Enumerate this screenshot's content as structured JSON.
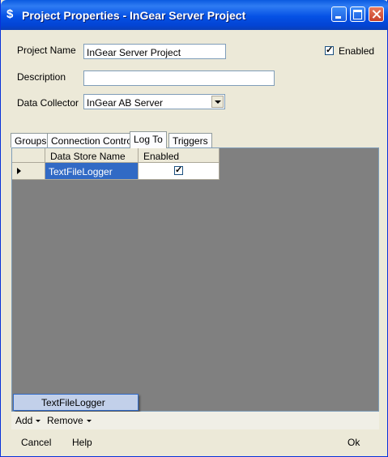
{
  "window": {
    "title": "Project Properties - InGear Server Project"
  },
  "form": {
    "project_name_label": "Project Name",
    "project_name_value": "InGear Server Project",
    "enabled_label": "Enabled",
    "enabled_checked": true,
    "description_label": "Description",
    "description_value": "",
    "data_collector_label": "Data Collector",
    "data_collector_value": "InGear AB Server"
  },
  "tabs": [
    "Groups",
    "Connection Control",
    "Log To",
    "Triggers"
  ],
  "active_tab": "Log To",
  "grid": {
    "columns": [
      "Data Store Name",
      "Enabled"
    ],
    "rows": [
      {
        "name": "TextFileLogger",
        "enabled": true
      }
    ]
  },
  "popup": {
    "item": "TextFileLogger"
  },
  "toolstrip": {
    "add_label": "Add",
    "remove_label": "Remove"
  },
  "buttons": {
    "cancel": "Cancel",
    "help": "Help",
    "ok": "Ok"
  },
  "colors": {
    "title_bar": "#0551e5",
    "selection": "#316ac5",
    "grid_background": "#808080"
  }
}
